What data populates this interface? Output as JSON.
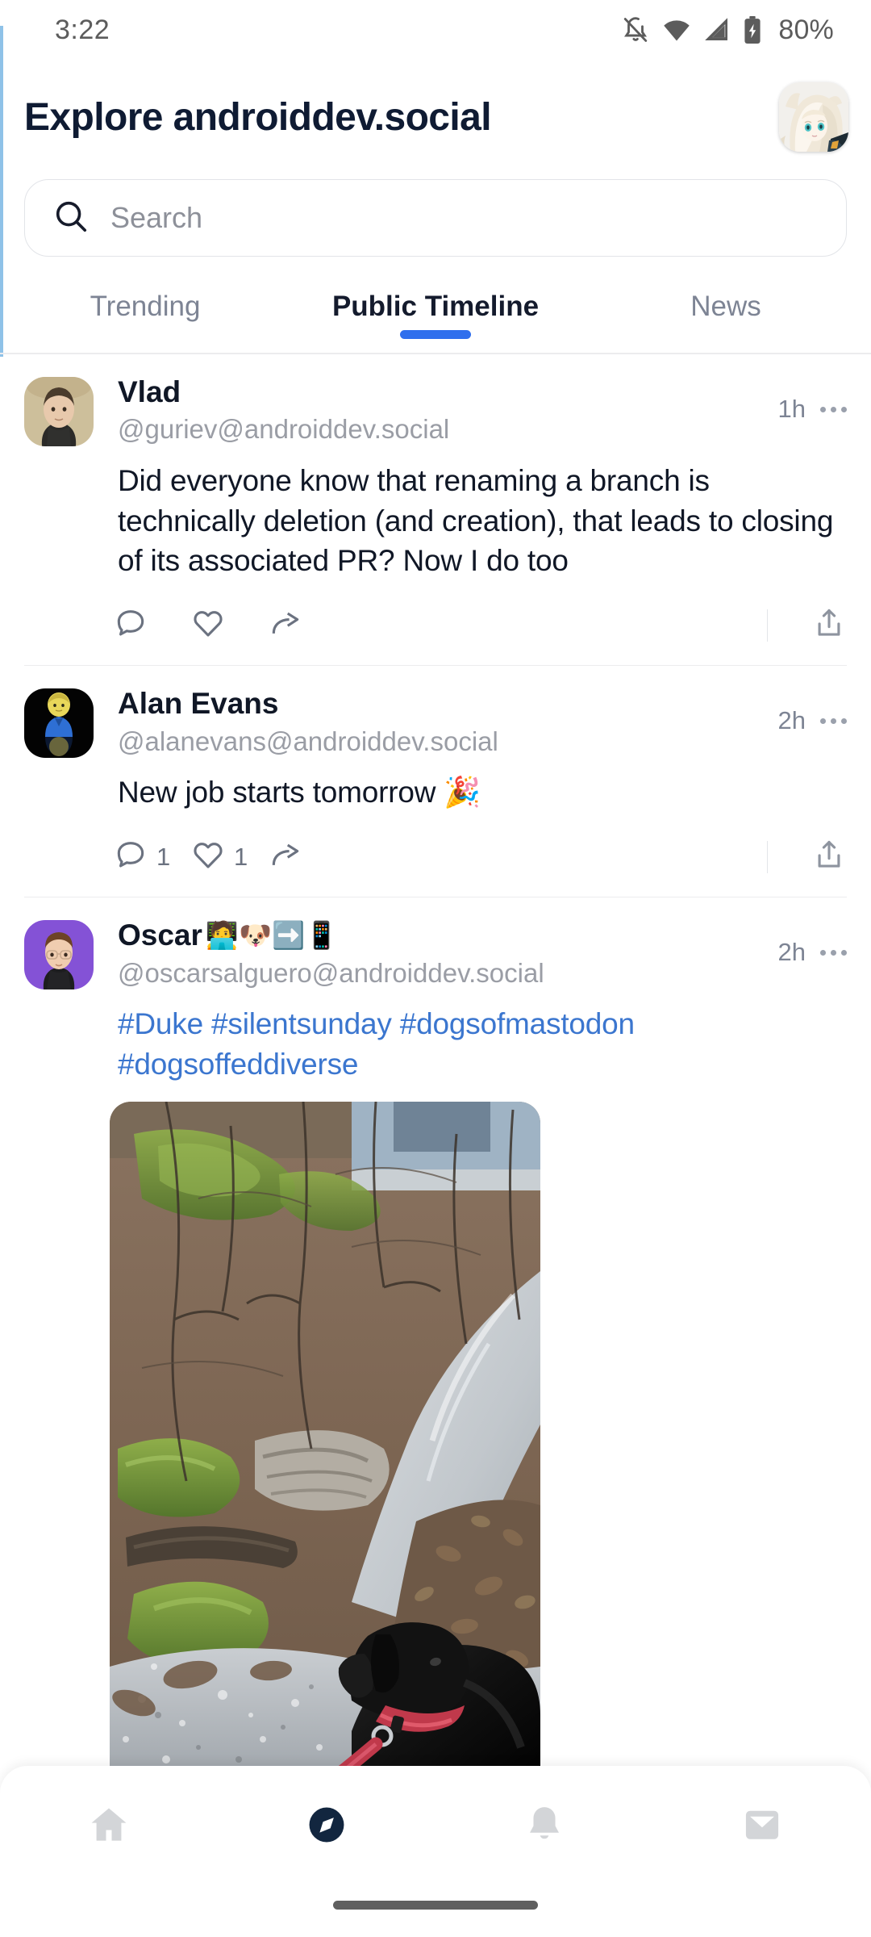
{
  "status_bar": {
    "time": "3:22",
    "battery_percent": "80%",
    "icons": [
      "bell-off-icon",
      "wifi-icon",
      "signal-icon",
      "battery-charging-icon"
    ]
  },
  "header": {
    "title": "Explore androiddev.social",
    "avatar_name": "profile-avatar"
  },
  "search": {
    "placeholder": "Search",
    "value": "",
    "icon": "search-icon"
  },
  "tabs": [
    {
      "label": "Trending",
      "active": false
    },
    {
      "label": "Public Timeline",
      "active": true
    },
    {
      "label": "News",
      "active": false
    }
  ],
  "accent_color": "#2f6fed",
  "link_color": "#3b76cf",
  "posts": [
    {
      "display_name": "Vlad",
      "emoji": "",
      "handle": "@guriev@androiddev.social",
      "time": "1h",
      "body": "Did everyone know that renaming a branch is technically deletion (and creation), that leads to closing of its associated PR? Now I do too",
      "is_hashtags": false,
      "reply_count": "",
      "favorite_count": "",
      "boost_count": "",
      "has_image": false
    },
    {
      "display_name": "Alan Evans",
      "emoji": "",
      "handle": "@alanevans@androiddev.social",
      "time": "2h",
      "body": "New job starts tomorrow 🎉",
      "is_hashtags": false,
      "reply_count": "1",
      "favorite_count": "1",
      "boost_count": "",
      "has_image": false
    },
    {
      "display_name": "Oscar",
      "emoji": "🧑‍💻🐶➡️📱",
      "handle": "@oscarsalguero@androiddev.social",
      "time": "2h",
      "body": "#Duke #silentsunday #dogsofmastodon #dogsoffeddiverse",
      "is_hashtags": true,
      "reply_count": "",
      "favorite_count": "",
      "boost_count": "",
      "has_image": true,
      "image_alt": "Black dog with red collar and leash on a forest path with moss, fallen leaves and a stream"
    }
  ],
  "post_actions": {
    "reply": "reply-icon",
    "favorite": "heart-icon",
    "boost": "boost-icon",
    "share": "share-icon"
  },
  "bottom_nav": [
    {
      "name": "home",
      "icon": "home-icon",
      "active": false
    },
    {
      "name": "explore",
      "icon": "compass-icon",
      "active": true
    },
    {
      "name": "notifications",
      "icon": "bell-icon",
      "active": false
    },
    {
      "name": "messages",
      "icon": "mail-icon",
      "active": false
    }
  ]
}
